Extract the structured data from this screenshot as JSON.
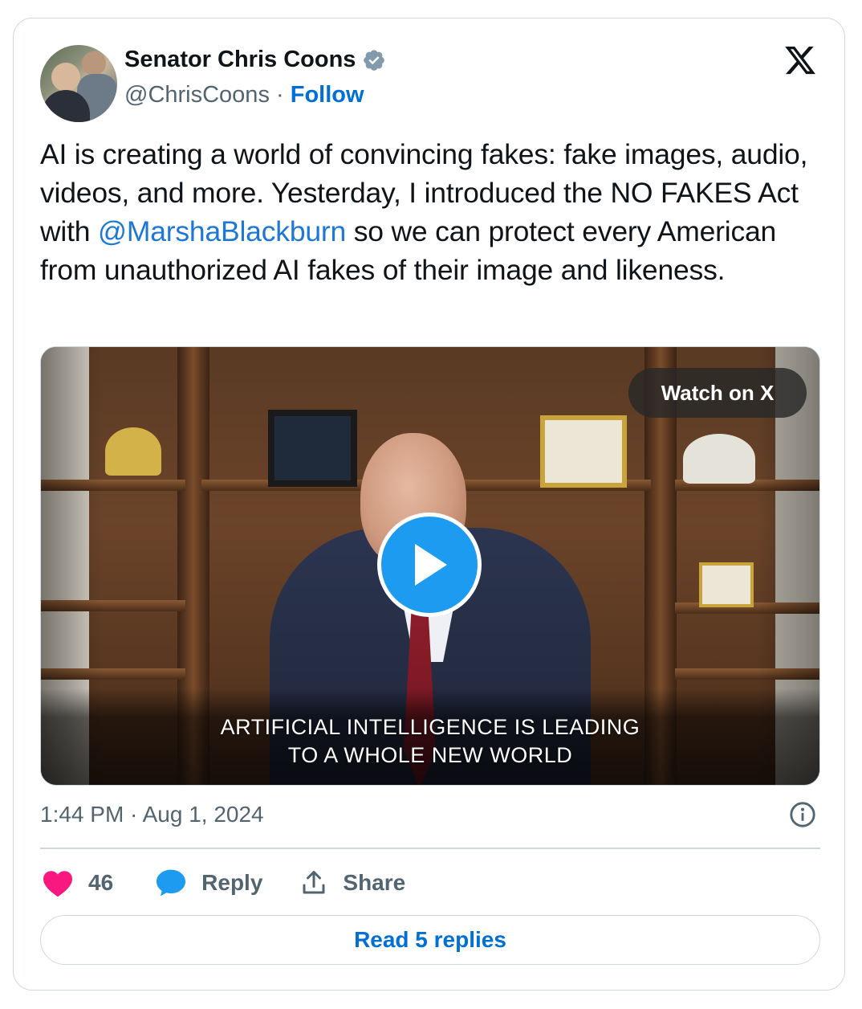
{
  "author": {
    "name": "Senator Chris Coons",
    "handle": "@ChrisCoons",
    "separator": "·",
    "follow_label": "Follow",
    "verified": true
  },
  "brand": {
    "logo": "x-logo-icon"
  },
  "tweet": {
    "text_before": "AI is creating a world of convincing fakes: fake images, audio, videos, and more. Yesterday, I introduced the NO FAKES Act with ",
    "mention": "@MarshaBlackburn",
    "text_after": " so we can protect every American from unauthorized AI fakes of their image and likeness."
  },
  "media": {
    "watch_label": "Watch on X",
    "caption_line1": "ARTIFICIAL INTELLIGENCE IS LEADING",
    "caption_line2": "TO A WHOLE NEW WORLD",
    "play_icon": "play-icon"
  },
  "meta": {
    "timestamp": "1:44 PM · Aug 1, 2024"
  },
  "actions": {
    "like_count": "46",
    "reply_label": "Reply",
    "share_label": "Share"
  },
  "read_replies_label": "Read 5 replies",
  "colors": {
    "accent": "#1d9bf0",
    "link": "#006fd6",
    "like": "#f91880",
    "muted": "#536471",
    "border": "#cfd9de"
  }
}
